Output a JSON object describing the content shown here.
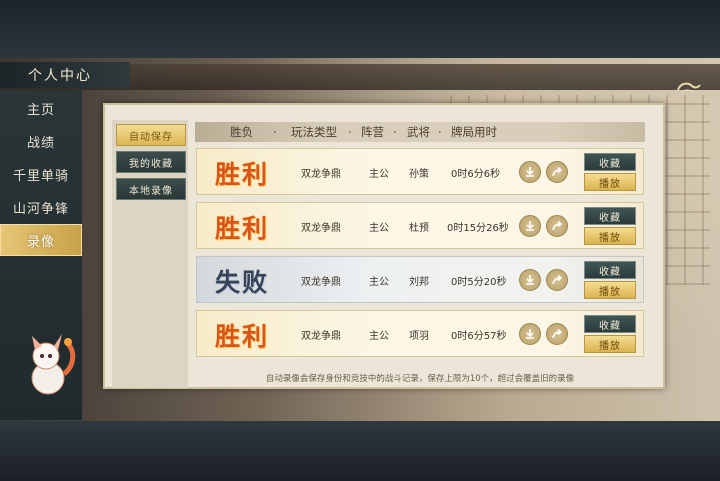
{
  "sidebar": {
    "title": "个人中心",
    "items": [
      {
        "label": "主页",
        "active": false
      },
      {
        "label": "战绩",
        "active": false
      },
      {
        "label": "千里单骑",
        "active": false
      },
      {
        "label": "山河争锋",
        "active": false
      },
      {
        "label": "录像",
        "active": true
      }
    ]
  },
  "subtabs": [
    {
      "label": "自动保存",
      "active": true
    },
    {
      "label": "我的收藏",
      "active": false
    },
    {
      "label": "本地录像",
      "active": false
    }
  ],
  "columns": {
    "result": "胜负",
    "mode": "玩法类型",
    "camp": "阵营",
    "general": "武将",
    "duration": "牌局用时",
    "sep": "·"
  },
  "records": [
    {
      "result": "胜利",
      "mode": "双龙争鼎",
      "camp": "主公",
      "general": "孙策",
      "duration": "0时6分6秒",
      "fav_label": "收藏",
      "play_label": "播放",
      "win": true
    },
    {
      "result": "胜利",
      "mode": "双龙争鼎",
      "camp": "主公",
      "general": "杜预",
      "duration": "0时15分26秒",
      "fav_label": "收藏",
      "play_label": "播放",
      "win": true
    },
    {
      "result": "失败",
      "mode": "双龙争鼎",
      "camp": "主公",
      "general": "刘邦",
      "duration": "0时5分20秒",
      "fav_label": "收藏",
      "play_label": "播放",
      "win": false
    },
    {
      "result": "胜利",
      "mode": "双龙争鼎",
      "camp": "主公",
      "general": "项羽",
      "duration": "0时6分57秒",
      "fav_label": "收藏",
      "play_label": "播放",
      "win": true
    }
  ],
  "footer_note": "自动录像会保存身份和竞技中的战斗记录，保存上限为10个，超过会覆盖旧的录像",
  "colors": {
    "accent_gold": "#dcb654",
    "win_red": "#d9541b",
    "loss_blue": "#34445a",
    "button_teal": "#2b3a3a"
  }
}
